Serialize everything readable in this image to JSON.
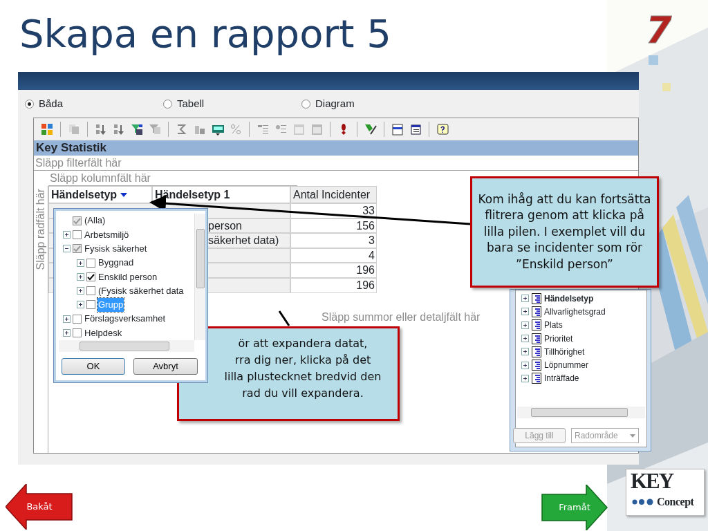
{
  "slide": {
    "title": "Skapa en rapport 5",
    "number": "7"
  },
  "view_options": [
    {
      "label": "Båda",
      "selected": true
    },
    {
      "label": "Tabell",
      "selected": false
    },
    {
      "label": "Diagram",
      "selected": false
    }
  ],
  "pivot": {
    "title": "Key Statistik",
    "filter_drop": "Släpp filterfält här",
    "column_drop": "Släpp kolumnfält här",
    "row_drop": "Släpp radfält här",
    "data_drop": "Släpp summor eller detaljfält här",
    "columns": [
      "Händelsetyp",
      "Händelsetyp 1",
      "Antal Incidenter"
    ],
    "rows": [
      {
        "value": "33"
      },
      {
        "label": "person",
        "value": "156"
      },
      {
        "label": "säkerhet data)",
        "value": "3"
      },
      {
        "value": "4"
      },
      {
        "value": "196"
      },
      {
        "value": "196"
      }
    ]
  },
  "filter_popup": {
    "items": [
      {
        "label": "(Alla)",
        "checked": true,
        "mixed": true,
        "selected": false
      },
      {
        "label": "Arbetsmiljö",
        "checked": false,
        "selected": false,
        "expanded": false
      },
      {
        "label": "Fysisk säkerhet",
        "checked": true,
        "mixed": true,
        "selected": false,
        "expanded": true,
        "children": [
          {
            "label": "Byggnad",
            "checked": false,
            "selected": false,
            "expanded": false
          },
          {
            "label": "Enskild person",
            "checked": true,
            "selected": false,
            "expanded": false
          },
          {
            "label": "(Fysisk säkerhet data",
            "checked": false,
            "selected": false,
            "expanded": false
          },
          {
            "label": "Grupp",
            "checked": false,
            "selected": true,
            "expanded": false
          }
        ]
      },
      {
        "label": "Förslagsverksamhet",
        "checked": false,
        "selected": false,
        "expanded": false
      },
      {
        "label": "Helpdesk",
        "checked": false,
        "selected": false,
        "expanded": false
      }
    ],
    "buttons": [
      "OK",
      "Avbryt"
    ]
  },
  "field_list": {
    "items": [
      {
        "label": "Händelsetyp",
        "in_use": true
      },
      {
        "label": "Allvarlighetsgrad",
        "in_use": false
      },
      {
        "label": "Plats",
        "in_use": false
      },
      {
        "label": "Prioritet",
        "in_use": false
      },
      {
        "label": "Tillhörighet",
        "in_use": false
      },
      {
        "label": "Löpnummer",
        "in_use": false
      },
      {
        "label": "Inträffade",
        "in_use": false
      }
    ],
    "add_button": {
      "label": "Lägg till",
      "disabled": true
    },
    "area_select": {
      "value": "Radområde",
      "disabled": true
    }
  },
  "callouts": [
    {
      "lines": [
        "Kom ihåg att du kan fortsätta flitrera genom att klicka på lilla pilen. I exemplet vill du bara se incidenter som rör ”Enskild person”"
      ]
    },
    {
      "lines": [
        "ör att expandera datat,",
        "rra dig ner, klicka på det",
        "lilla plustecknet bredvid den",
        "rad du vill expandera."
      ]
    }
  ],
  "nav": {
    "back": "Bakåt",
    "forward": "Framåt"
  },
  "logo": {
    "line1": "KEY",
    "line2": "Concept"
  }
}
